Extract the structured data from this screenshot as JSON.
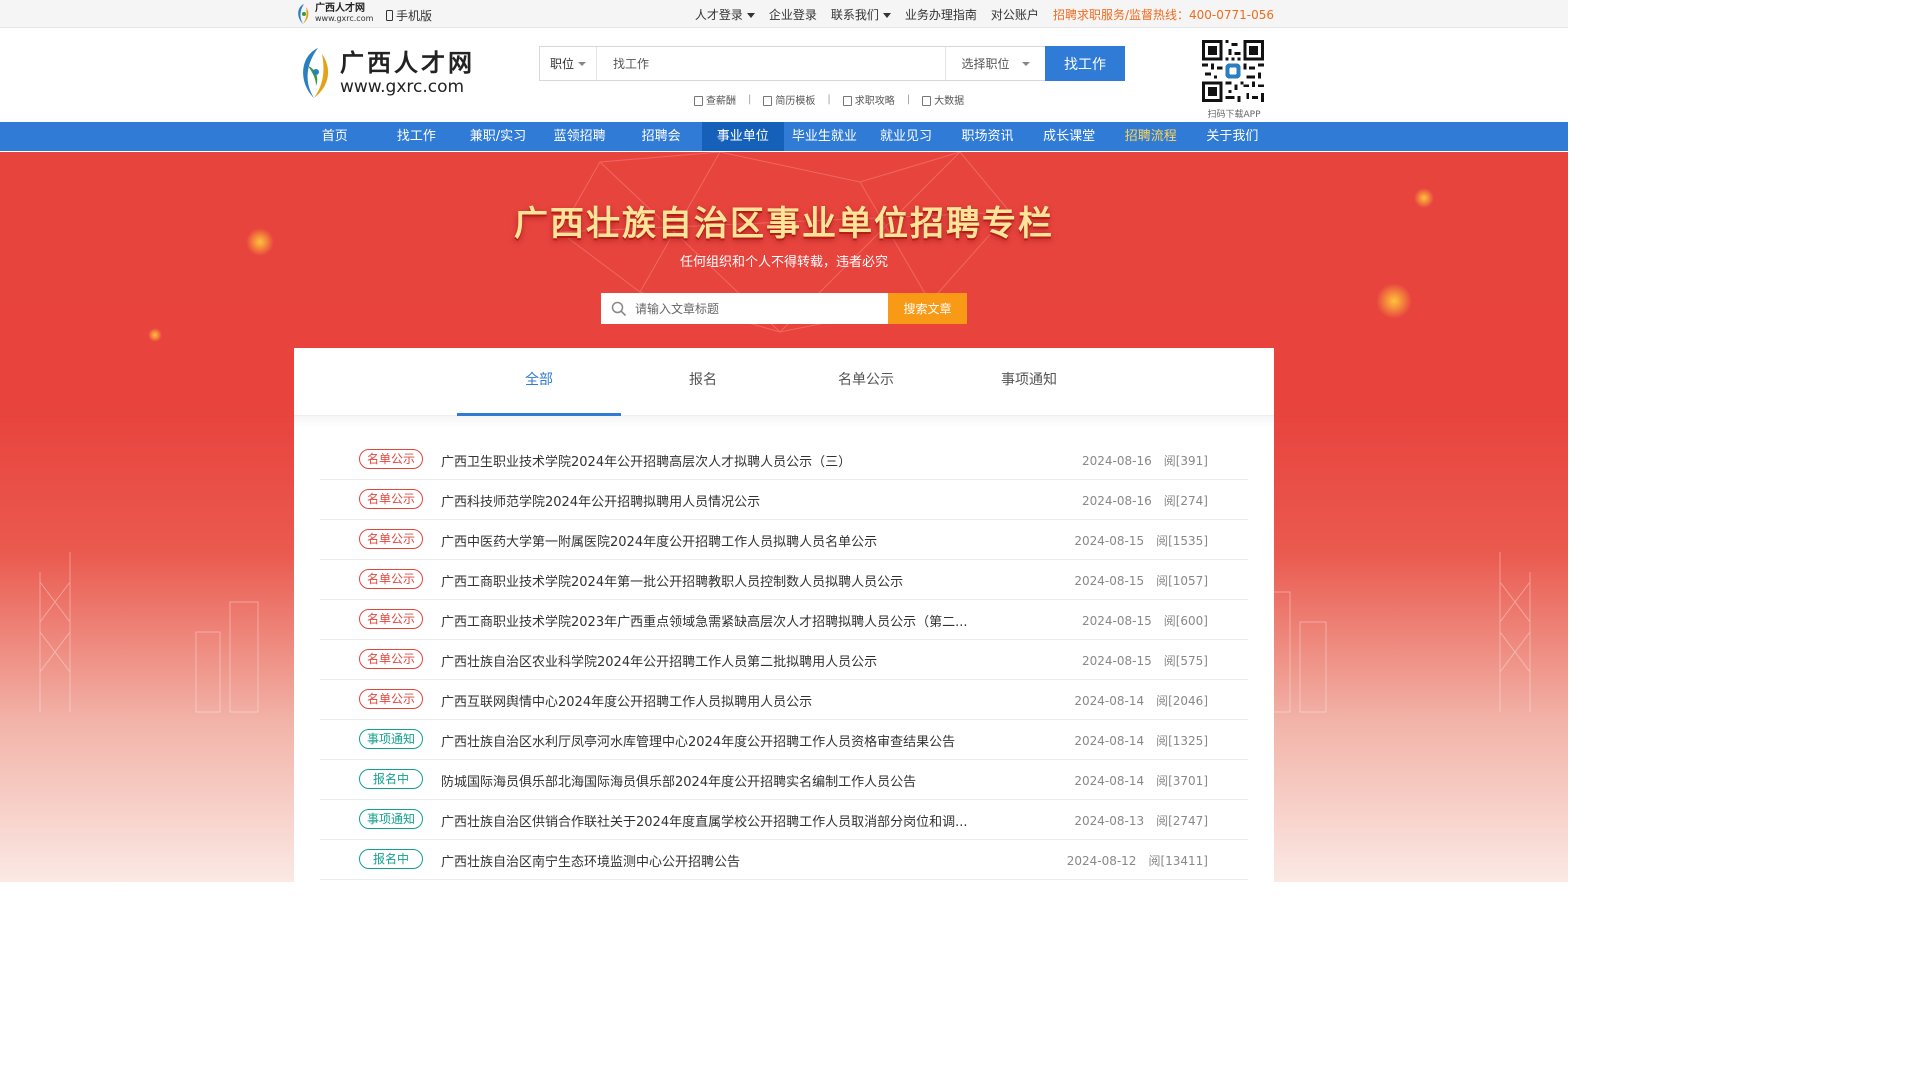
{
  "topbar": {
    "mini_logo_cn": "广西人才网",
    "mini_logo_en": "www.gxrc.com",
    "mobile": "手机版",
    "links": [
      {
        "label": "人才登录",
        "dropdown": true
      },
      {
        "label": "企业登录",
        "dropdown": false
      },
      {
        "label": "联系我们",
        "dropdown": true
      },
      {
        "label": "业务办理指南",
        "dropdown": false
      },
      {
        "label": "对公账户",
        "dropdown": false
      }
    ],
    "hotline": "招聘求职服务/监督热线：400-0771-056"
  },
  "header": {
    "logo_cn": "广西人才网",
    "logo_en": "www.gxrc.com",
    "search_type": "职位",
    "search_placeholder": "找工作",
    "search_select": "选择职位",
    "search_button": "找工作",
    "quick_links": [
      "查薪酬",
      "简历模板",
      "求职攻略",
      "大数据"
    ],
    "qr_caption": "扫码下载APP"
  },
  "nav": {
    "items": [
      "首页",
      "找工作",
      "兼职/实习",
      "蓝领招聘",
      "招聘会",
      "事业单位",
      "毕业生就业",
      "就业见习",
      "职场资讯",
      "成长课堂",
      "招聘流程",
      "关于我们"
    ],
    "active": "事业单位",
    "highlight": "招聘流程"
  },
  "banner": {
    "title": "广西壮族自治区事业单位招聘专栏",
    "subtitle": "任何组织和个人不得转载，违者必究",
    "search_placeholder": "请输入文章标题",
    "search_button": "搜索文章"
  },
  "tabs": [
    "全部",
    "报名",
    "名单公示",
    "事项通知"
  ],
  "active_tab": "全部",
  "colors": {
    "primary": "#2f7bd5",
    "hotline": "#f26b1d",
    "badge_red": "#e2463d",
    "badge_teal": "#13a08e",
    "search_orange": "#f99a16"
  },
  "articles": [
    {
      "tag": "名单公示",
      "tag_color": "red",
      "title": "广西卫生职业技术学院2024年公开招聘高层次人才拟聘人员公示（三）",
      "date": "2024-08-16",
      "views": "阅[391]"
    },
    {
      "tag": "名单公示",
      "tag_color": "red",
      "title": "广西科技师范学院2024年公开招聘拟聘用人员情况公示",
      "date": "2024-08-16",
      "views": "阅[274]"
    },
    {
      "tag": "名单公示",
      "tag_color": "red",
      "title": "广西中医药大学第一附属医院2024年度公开招聘工作人员拟聘人员名单公示",
      "date": "2024-08-15",
      "views": "阅[1535]"
    },
    {
      "tag": "名单公示",
      "tag_color": "red",
      "title": "广西工商职业技术学院2024年第一批公开招聘教职人员控制数人员拟聘人员公示",
      "date": "2024-08-15",
      "views": "阅[1057]"
    },
    {
      "tag": "名单公示",
      "tag_color": "red",
      "title": "广西工商职业技术学院2023年广西重点领域急需紧缺高层次人才招聘拟聘人员公示（第二...",
      "date": "2024-08-15",
      "views": "阅[600]"
    },
    {
      "tag": "名单公示",
      "tag_color": "red",
      "title": "广西壮族自治区农业科学院2024年公开招聘工作人员第二批拟聘用人员公示",
      "date": "2024-08-15",
      "views": "阅[575]"
    },
    {
      "tag": "名单公示",
      "tag_color": "red",
      "title": "广西互联网舆情中心2024年度公开招聘工作人员拟聘用人员公示",
      "date": "2024-08-14",
      "views": "阅[2046]"
    },
    {
      "tag": "事项通知",
      "tag_color": "teal",
      "title": "广西壮族自治区水利厅凤亭河水库管理中心2024年度公开招聘工作人员资格审查结果公告",
      "date": "2024-08-14",
      "views": "阅[1325]"
    },
    {
      "tag": "报名中",
      "tag_color": "teal",
      "title": "防城国际海员俱乐部北海国际海员俱乐部2024年度公开招聘实名编制工作人员公告",
      "date": "2024-08-14",
      "views": "阅[3701]"
    },
    {
      "tag": "事项通知",
      "tag_color": "teal",
      "title": "广西壮族自治区供销合作联社关于2024年度直属学校公开招聘工作人员取消部分岗位和调...",
      "date": "2024-08-13",
      "views": "阅[2747]"
    },
    {
      "tag": "报名中",
      "tag_color": "teal",
      "title": "广西壮族自治区南宁生态环境监测中心公开招聘公告",
      "date": "2024-08-12",
      "views": "阅[13411]"
    }
  ]
}
